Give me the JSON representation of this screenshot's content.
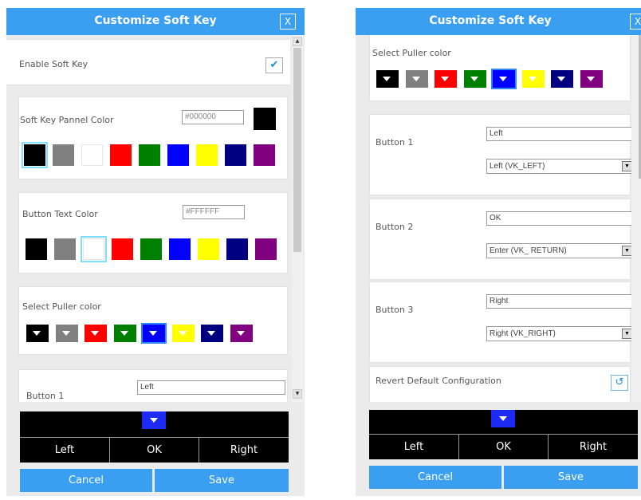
{
  "left_dialog": {
    "title": "Customize Soft Key",
    "close_label": "X",
    "enable_soft_key": {
      "label": "Enable Soft Key",
      "checked": true,
      "check_glyph": "✔"
    },
    "panel_color": {
      "label": "Soft Key Pannel Color",
      "value": "#000000",
      "preview_color": "#000000"
    },
    "button_text_color": {
      "label": "Button Text Color",
      "value": "#FFFFFF"
    },
    "puller_color": {
      "label": "Select Puller color"
    },
    "button1": {
      "label": "Button 1",
      "text_value": "Left"
    },
    "softkey": {
      "left": "Left",
      "ok": "OK",
      "right": "Right"
    },
    "cancel_label": "Cancel",
    "save_label": "Save"
  },
  "right_dialog": {
    "title": "Customize Soft Key",
    "close_label": "X",
    "puller_color": {
      "label": "Select Puller color"
    },
    "button1": {
      "label": "Button 1",
      "text_value": "Left",
      "key_value": "Left (VK_LEFT)"
    },
    "button2": {
      "label": "Button 2",
      "text_value": "OK",
      "key_value": "Enter (VK_ RETURN)"
    },
    "button3": {
      "label": "Button 3",
      "text_value": "Right",
      "key_value": "Right (VK_RIGHT)"
    },
    "revert": {
      "label": "Revert Default Configuration",
      "icon": "revert-icon",
      "glyph": "↺"
    },
    "softkey": {
      "left": "Left",
      "ok": "OK",
      "right": "Right"
    },
    "cancel_label": "Cancel",
    "save_label": "Save"
  },
  "palette": [
    "#000000",
    "#808080",
    "#ffffff",
    "#ff0000",
    "#008000",
    "#0000ff",
    "#ffff00",
    "#000080",
    "#800080"
  ],
  "puller_palette": [
    "#000000",
    "#808080",
    "#ff0000",
    "#008000",
    "#0000ff",
    "#ffff00",
    "#000080",
    "#800080"
  ],
  "colors": {
    "title_bar": "#3a9ff0",
    "accent": "#3a9ff0",
    "softkey_panel": "#000000",
    "puller_selected": "#1e2bf5"
  },
  "selection": {
    "panel_color_index": 0,
    "text_color_index": 2,
    "puller_color_index": 4
  }
}
